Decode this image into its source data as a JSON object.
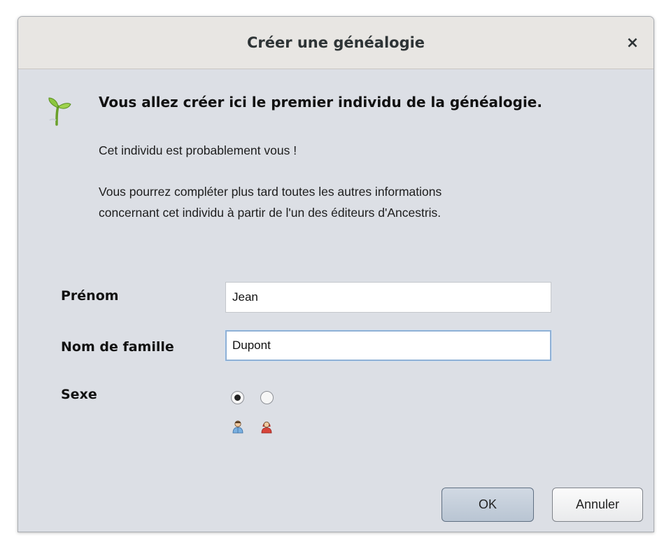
{
  "window": {
    "title": "Créer une généalogie",
    "close_glyph": "×"
  },
  "intro": {
    "heading": "Vous allez créer ici le premier individu de la généalogie.",
    "line1": "Cet individu est probablement vous !",
    "line2": "Vous pourrez compléter plus tard toutes les autres informations",
    "line3": "concernant cet individu à partir de l'un des éditeurs d'Ancestris."
  },
  "form": {
    "firstname_label": "Prénom",
    "firstname_value": "Jean",
    "lastname_label": "Nom de famille",
    "lastname_value": "Dupont",
    "sex_label": "Sexe",
    "sex_selected": "male"
  },
  "buttons": {
    "ok": "OK",
    "cancel": "Annuler"
  },
  "icons": {
    "header": "sprout-icon",
    "male": "male-person-icon",
    "female": "female-person-icon"
  },
  "colors": {
    "dialog_bg": "#dcdfe5",
    "titlebar_bg": "#e8e6e3",
    "focus_border": "#8fb1d6"
  }
}
